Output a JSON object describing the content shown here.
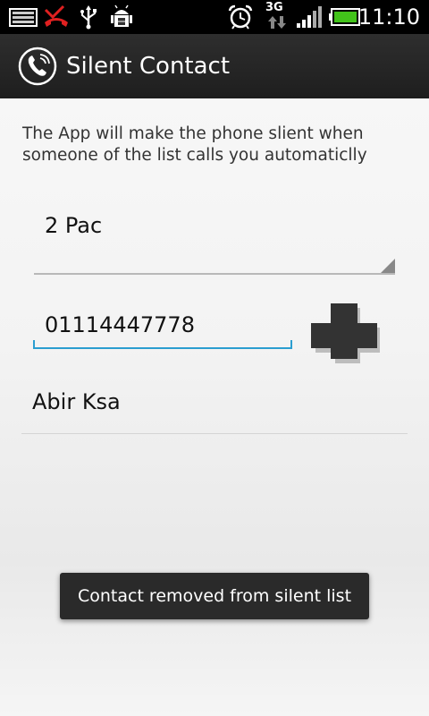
{
  "status_bar": {
    "time": "11:10",
    "network_label": "3G",
    "battery_color": "#42c31a",
    "icons": [
      "message-icon",
      "missed-call-icon",
      "usb-icon",
      "android-debug-icon",
      "alarm-icon",
      "3g-data-icon",
      "signal-icon",
      "battery-icon"
    ]
  },
  "action_bar": {
    "title": "Silent Contact",
    "icon": "phone-handset-icon"
  },
  "main": {
    "description": "The App will make the phone slient when someone of the list calls you automaticlly",
    "contact_spinner": {
      "selected": "2 Pac"
    },
    "phone_input": {
      "value": "01114447778",
      "accent_color": "#2b9ed0"
    },
    "add_button": {
      "icon": "plus-icon"
    },
    "silent_list": [
      {
        "name": "Abir Ksa"
      }
    ]
  },
  "toast": {
    "message": "Contact removed from silent list"
  }
}
